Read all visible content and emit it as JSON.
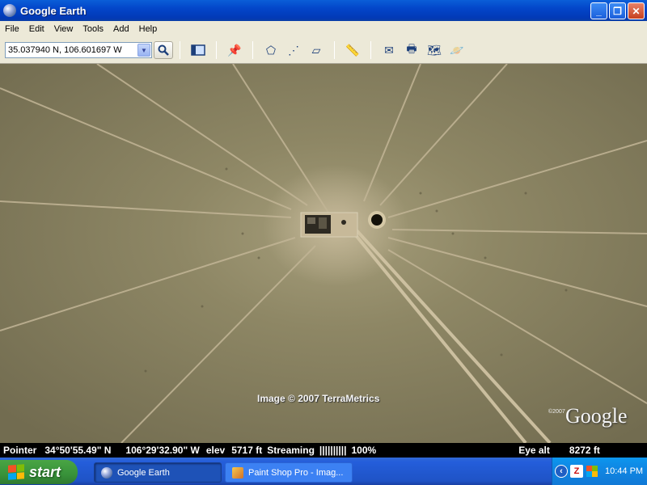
{
  "window": {
    "title": "Google Earth"
  },
  "menu": [
    "File",
    "Edit",
    "View",
    "Tools",
    "Add",
    "Help"
  ],
  "toolbar": {
    "search_value": "35.037940 N, 106.601697 W"
  },
  "map": {
    "attribution": "Image © 2007 TerraMetrics",
    "brand": "Google",
    "brand_sup": "©2007"
  },
  "status": {
    "pointer_label": "Pointer",
    "lat": "34°50'55.49\" N",
    "lon": "106°29'32.90\" W",
    "elev_label": "elev",
    "elev_value": "5717 ft",
    "streaming_label": "Streaming",
    "streaming_bar": "||||||||||",
    "streaming_pct": "100%",
    "eye_label": "Eye alt",
    "eye_value": "8272 ft"
  },
  "taskbar": {
    "start_label": "start",
    "tasks": [
      {
        "label": "Google Earth"
      },
      {
        "label": "Paint Shop Pro - Imag..."
      }
    ],
    "clock": "10:44 PM"
  },
  "colors": {
    "titlebar": "#0346c9",
    "chrome": "#ece9d8",
    "terrain": "#8b8463",
    "taskbar": "#245edb",
    "start": "#38923a",
    "tray": "#0f8ae6"
  },
  "icons": {
    "search": "search-icon",
    "sidebar": "sidebar-toggle-icon",
    "placemark": "placemark-icon",
    "polygon": "polygon-icon",
    "path": "path-icon",
    "overlay": "image-overlay-icon",
    "ruler": "ruler-icon",
    "email": "email-icon",
    "print": "print-icon",
    "maps": "google-maps-icon",
    "sky": "sky-icon"
  }
}
